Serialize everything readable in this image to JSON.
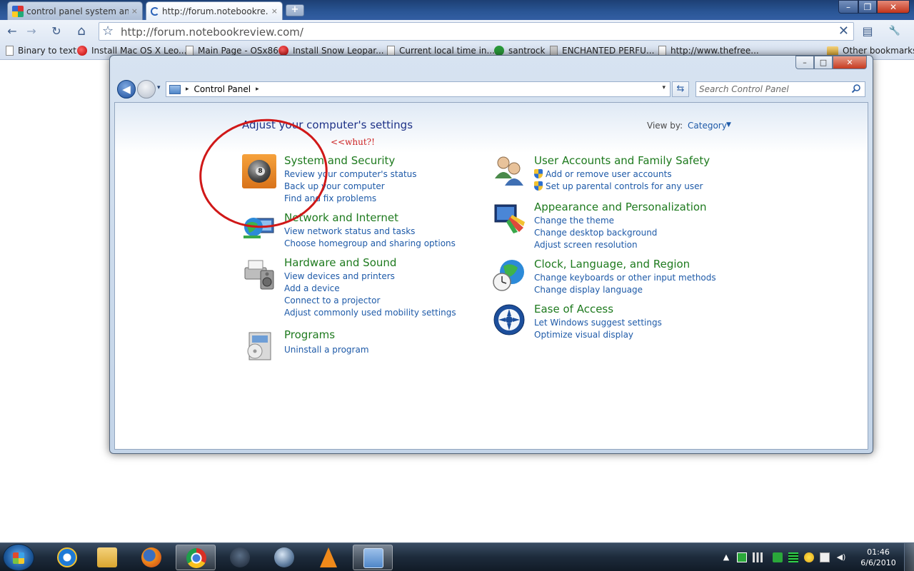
{
  "browser": {
    "tabs": [
      {
        "title": "control panel system and...",
        "close": "×"
      },
      {
        "title": "http://forum.notebookre...",
        "close": "×"
      }
    ],
    "new_tab": "+",
    "window_controls": {
      "minimize": "–",
      "maximize": "❐",
      "close": "✕"
    },
    "toolbar": {
      "back": "←",
      "forward": "→",
      "reload": "↻",
      "home": "⌂",
      "page_menu": "▤",
      "wrench": "🔧"
    },
    "omnibox": {
      "url": "http://forum.notebookreview.com/",
      "star": "☆",
      "stop": "✕"
    },
    "bookmarks": [
      {
        "label": "Binary to text",
        "icon": "page"
      },
      {
        "label": "Install Mac OS X Leo...",
        "icon": "red"
      },
      {
        "label": "Main Page - OSx86",
        "icon": "page"
      },
      {
        "label": "Install Snow Leopar...",
        "icon": "red"
      },
      {
        "label": "Current local time in...",
        "icon": "page"
      },
      {
        "label": "santrock",
        "icon": "green"
      },
      {
        "label": "ENCHANTED PERFU...",
        "icon": "grey"
      },
      {
        "label": "http://www.thefree...",
        "icon": "page"
      },
      {
        "label": "Other bookmarks",
        "icon": "folder"
      }
    ]
  },
  "control_panel": {
    "window_controls": {
      "minimize": "–",
      "maximize": "□",
      "close": "✕"
    },
    "nav": {
      "back": "◀",
      "recent": "▾"
    },
    "breadcrumb": {
      "root": "Control Panel",
      "arrow": "▸",
      "dropdown": "▾"
    },
    "refresh": "⇆",
    "search": {
      "placeholder": "Search Control Panel"
    },
    "page_title": "Adjust your computer's settings",
    "view_by": {
      "label": "View by:",
      "value": "Category",
      "arrow": "▼"
    },
    "categories_left": [
      {
        "title": "System and Security",
        "links": [
          "Review your computer's status",
          "Back up your computer",
          "Find and fix problems"
        ]
      },
      {
        "title": "Network and Internet",
        "links": [
          "View network status and tasks",
          "Choose homegroup and sharing options"
        ]
      },
      {
        "title": "Hardware and Sound",
        "links": [
          "View devices and printers",
          "Add a device",
          "Connect to a projector",
          "Adjust commonly used mobility settings"
        ]
      },
      {
        "title": "Programs",
        "links": [
          "Uninstall a program"
        ]
      }
    ],
    "categories_right": [
      {
        "title": "User Accounts and Family Safety",
        "links": [
          "Add or remove user accounts",
          "Set up parental controls for any user"
        ]
      },
      {
        "title": "Appearance and Personalization",
        "links": [
          "Change the theme",
          "Change desktop background",
          "Adjust screen resolution"
        ]
      },
      {
        "title": "Clock, Language, and Region",
        "links": [
          "Change keyboards or other input methods",
          "Change display language"
        ]
      },
      {
        "title": "Ease of Access",
        "links": [
          "Let Windows suggest settings",
          "Optimize visual display"
        ]
      }
    ]
  },
  "annotation": {
    "text": "<<whut?!",
    "color": "#cc1f1f"
  },
  "taskbar": {
    "apps": [
      "internet-explorer",
      "windows-explorer",
      "firefox",
      "chrome",
      "media-app",
      "orb-app",
      "vlc",
      "control-panel"
    ],
    "tray_arrow": "▲",
    "clock": {
      "time": "01:46",
      "date": "6/6/2010"
    }
  },
  "colors": {
    "link": "#1e5aa8",
    "category_title": "#1e7a1e",
    "page_title": "#1e3287"
  }
}
